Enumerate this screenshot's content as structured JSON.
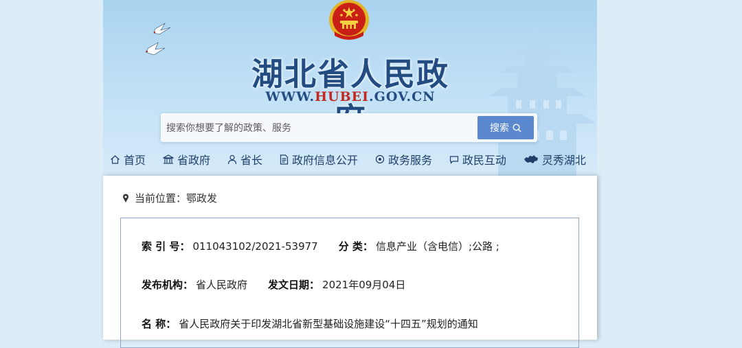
{
  "header": {
    "site_title": "湖北省人民政府",
    "site_url_prefix": "WWW.",
    "site_url_accent": "HUBEI",
    "site_url_suffix": ".GOV.CN"
  },
  "search": {
    "placeholder": "搜索你想要了解的政策、服务",
    "button_label": "搜索"
  },
  "nav": {
    "items": [
      {
        "label": "首页",
        "icon": "home-icon"
      },
      {
        "label": "省政府",
        "icon": "building-icon"
      },
      {
        "label": "省长",
        "icon": "person-icon"
      },
      {
        "label": "政府信息公开",
        "icon": "document-icon"
      },
      {
        "label": "政务服务",
        "icon": "service-icon"
      },
      {
        "label": "政民互动",
        "icon": "chat-icon"
      },
      {
        "label": "灵秀湖北",
        "icon": "hubei-map-icon"
      }
    ]
  },
  "breadcrumb": {
    "prefix": "当前位置：",
    "current": "鄂政发"
  },
  "doc_info": {
    "index_label": "索 引 号：",
    "index_value": "011043102/2021-53977",
    "category_label": "分 类：",
    "category_value": "信息产业（含电信）;公路 ;",
    "publisher_label": "发布机构：",
    "publisher_value": "省人民政府",
    "date_label": "发文日期：",
    "date_value": "2021年09月04日",
    "name_label": "名 称：",
    "name_value": "省人民政府关于印发湖北省新型基础设施建设“十四五”规划的通知"
  },
  "colors": {
    "page_bg": "#dcedf8",
    "banner_title": "#234d82",
    "url_accent": "#c3281f",
    "search_button": "#5b88cf",
    "nav_text": "#1f3f6a"
  }
}
